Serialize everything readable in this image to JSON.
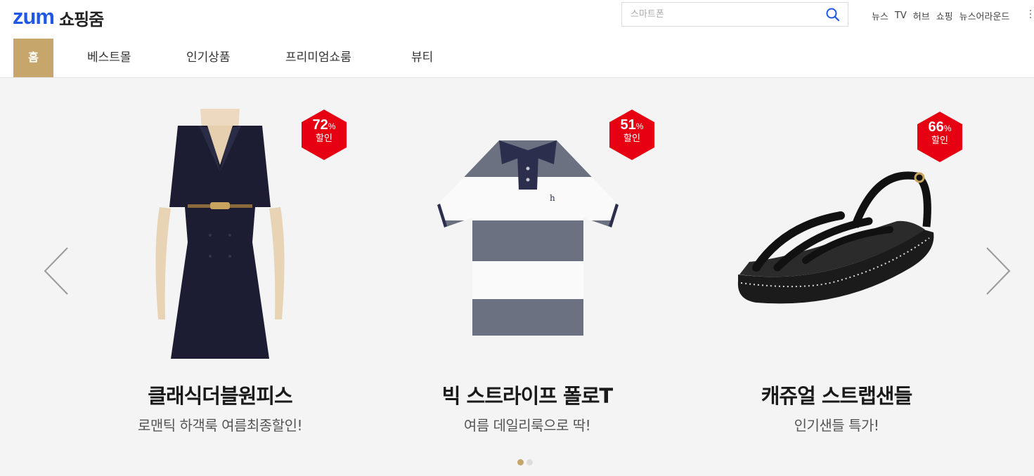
{
  "header": {
    "logo_brand": "zum",
    "logo_service": "쇼핑줌",
    "search_placeholder": "스마트폰",
    "top_links": [
      "뉴스",
      "TV",
      "허브",
      "쇼핑",
      "뉴스어라운드"
    ]
  },
  "nav": {
    "items": [
      "홈",
      "베스트몰",
      "인기상품",
      "프리미엄쇼룸",
      "뷰티"
    ]
  },
  "carousel": {
    "products": [
      {
        "title": "클래식더블원피스",
        "subtitle": "로맨틱 하객룩 여름최종할인!",
        "discount": "72",
        "percent_sign": "%",
        "discount_label": "할인",
        "icon": "navy-dress-image"
      },
      {
        "title": "빅 스트라이프 폴로T",
        "subtitle": "여름 데일리룩으로 딱!",
        "discount": "51",
        "percent_sign": "%",
        "discount_label": "할인",
        "icon": "striped-polo-image"
      },
      {
        "title": "캐쥬얼 스트랩샌들",
        "subtitle": "인기샌들 특가!",
        "discount": "66",
        "percent_sign": "%",
        "discount_label": "할인",
        "icon": "black-sandal-image"
      }
    ],
    "pagination": {
      "current": 1,
      "total": 2
    }
  },
  "colors": {
    "brand_blue": "#1f57e7",
    "nav_active": "#c7a66b",
    "badge_red": "#e60012",
    "carousel_bg": "#f4f4f4"
  }
}
